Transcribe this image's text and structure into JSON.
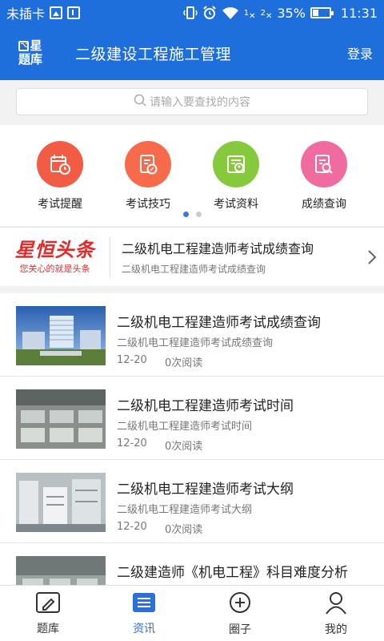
{
  "status_bar": {
    "carrier": "未插卡",
    "network1": "1",
    "network2": "2",
    "battery": "35%",
    "time": "11:31"
  },
  "header": {
    "logo_line1": "星",
    "logo_line2": "题库",
    "title": "二级建设工程施工管理",
    "login": "登录"
  },
  "search": {
    "placeholder": "请输入要查找的内容"
  },
  "categories": [
    {
      "label": "考试提醒",
      "color": "#f25c44",
      "icon": "calendar-clock-icon"
    },
    {
      "label": "考试技巧",
      "color": "#f86a4c",
      "icon": "edit-document-icon"
    },
    {
      "label": "考试资料",
      "color": "#86c93d",
      "icon": "profile-document-icon"
    },
    {
      "label": "成绩查询",
      "color": "#f06ba0",
      "icon": "search-document-icon"
    }
  ],
  "headline": {
    "brand": "星恒头条",
    "slogan": "您关心的就是头条",
    "title": "二级机电工程建造师考试成绩查询",
    "subtitle": "二级机电工程建造师考试成绩查询"
  },
  "news": [
    {
      "title": "二级机电工程建造师考试成绩查询",
      "subtitle": "二级机电工程建造师考试成绩查询",
      "date": "12-20",
      "reads": "0次阅读"
    },
    {
      "title": "二级机电工程建造师考试时间",
      "subtitle": "二级机电工程建造师考试时间",
      "date": "12-20",
      "reads": "0次阅读"
    },
    {
      "title": "二级机电工程建造师考试大纲",
      "subtitle": "二级机电工程建造师考试大纲",
      "date": "12-20",
      "reads": "0次阅读"
    },
    {
      "title": "二级建造师《机电工程》科目难度分析",
      "subtitle": "",
      "date": "",
      "reads": ""
    }
  ],
  "tabs": [
    {
      "label": "题库",
      "icon": "question-bank-icon"
    },
    {
      "label": "资讯",
      "icon": "news-icon"
    },
    {
      "label": "圈子",
      "icon": "circle-plus-icon"
    },
    {
      "label": "我的",
      "icon": "user-icon"
    }
  ],
  "colors": {
    "primary": "#1e6fdc",
    "active_tab": "#2c6fd6",
    "headline_red": "#e02b2b"
  }
}
